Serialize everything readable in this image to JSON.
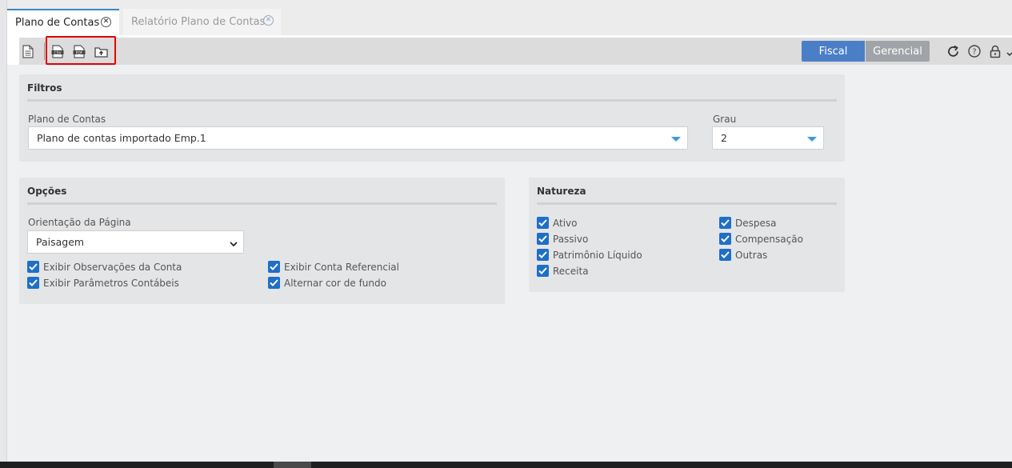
{
  "tabs": [
    {
      "label": "Plano de Contas",
      "active": true
    },
    {
      "label": "Relatório Plano de Contas",
      "active": false
    }
  ],
  "toolbar": {
    "icons": [
      "document-icon",
      "export-csv-icon",
      "export-pdf-icon",
      "export-folder-icon"
    ],
    "fiscal_label": "Fiscal",
    "gerencial_label": "Gerencial",
    "right_icons": [
      "refresh-icon",
      "help-icon",
      "lock-icon",
      "chevron-down-icon"
    ]
  },
  "filtros": {
    "title": "Filtros",
    "plano_label": "Plano de Contas",
    "plano_value": "Plano de contas importado Emp.1",
    "grau_label": "Grau",
    "grau_value": "2"
  },
  "opcoes": {
    "title": "Opções",
    "orientacao_label": "Orientação da Página",
    "orientacao_value": "Paisagem",
    "checkboxes": [
      {
        "label": "Exibir Observações da Conta",
        "checked": true
      },
      {
        "label": "Exibir Conta Referencial",
        "checked": true
      },
      {
        "label": "Exibir Parâmetros Contábeis",
        "checked": true
      },
      {
        "label": "Alternar cor de fundo",
        "checked": true
      }
    ]
  },
  "natureza": {
    "title": "Natureza",
    "checkboxes": [
      {
        "label": "Ativo",
        "checked": true
      },
      {
        "label": "Despesa",
        "checked": true
      },
      {
        "label": "Passivo",
        "checked": true
      },
      {
        "label": "Compensação",
        "checked": true
      },
      {
        "label": "Patrimônio Líquido",
        "checked": true
      },
      {
        "label": "Outras",
        "checked": true
      },
      {
        "label": "Receita",
        "checked": true
      }
    ]
  },
  "colors": {
    "accent": "#4a7fc8",
    "checkbox": "#1e6fc7",
    "highlight": "#e60000"
  }
}
